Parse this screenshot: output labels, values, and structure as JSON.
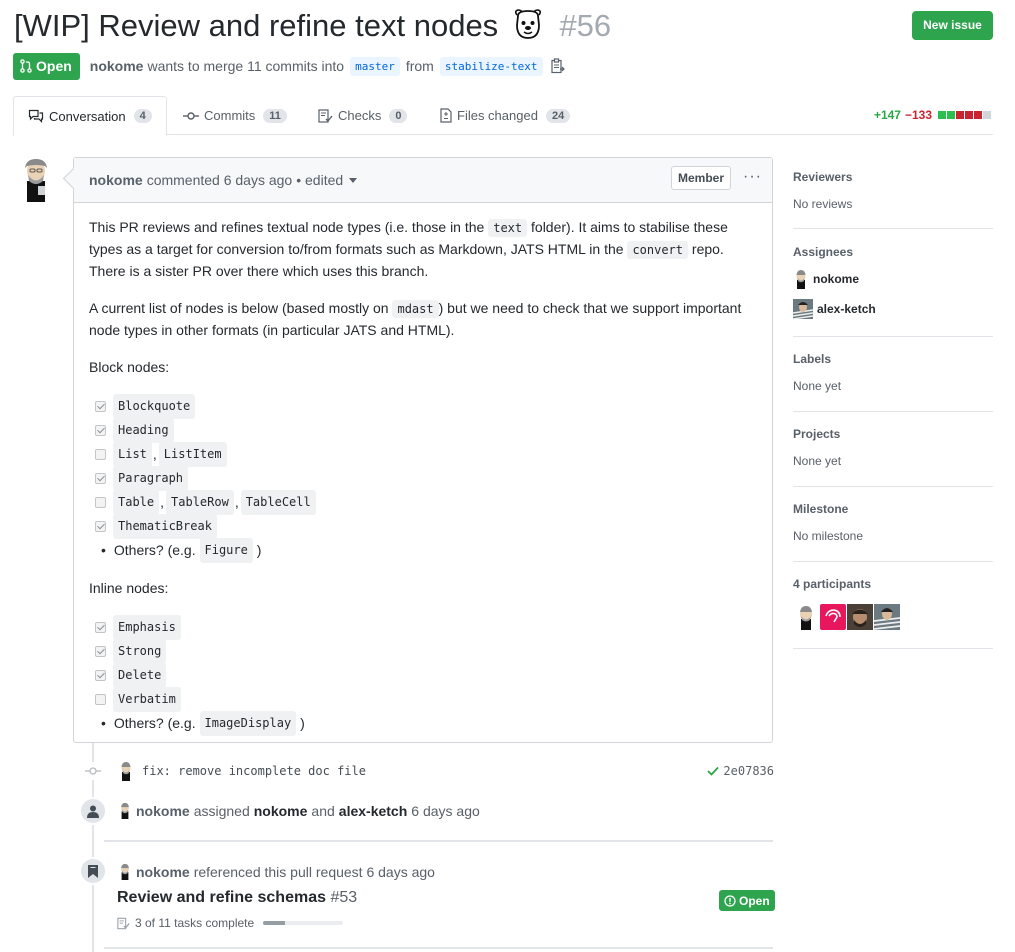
{
  "header": {
    "title": "[WIP] Review and refine text nodes",
    "number": "#56",
    "new_issue_label": "New issue",
    "state": "Open",
    "author": "nokome",
    "merge_text": "wants to merge 11 commits into",
    "base_branch": "master",
    "from_text": "from",
    "head_branch": "stabilize-text"
  },
  "tabs": [
    {
      "label": "Conversation",
      "count": "4"
    },
    {
      "label": "Commits",
      "count": "11"
    },
    {
      "label": "Checks",
      "count": "0"
    },
    {
      "label": "Files changed",
      "count": "24"
    }
  ],
  "diffstat": {
    "additions": "+147",
    "deletions": "−133",
    "blocks": [
      "add",
      "add",
      "del",
      "del",
      "del",
      "neutral"
    ]
  },
  "comment": {
    "author": "nokome",
    "action": "commented 6 days ago",
    "edited": "• edited",
    "role_badge": "Member",
    "p1_a": "This PR reviews and refines textual node types (i.e. those in the",
    "p1_code1": "text",
    "p1_b": "folder). It aims to stabilise these types as a target for conversion to/from formats such as Markdown, JATS HTML in the",
    "p1_code2": "convert",
    "p1_c": "repo. There is a sister PR over there which uses this branch.",
    "p2_a": "A current list of nodes is below (based mostly on",
    "p2_code": "mdast",
    "p2_b": ") but we need to check that we support important node types in other formats (in particular JATS and HTML).",
    "block_heading": "Block nodes:",
    "block_tasks": [
      {
        "checked": true,
        "items": [
          "Blockquote"
        ]
      },
      {
        "checked": true,
        "items": [
          "Heading"
        ]
      },
      {
        "checked": false,
        "items": [
          "List",
          "ListItem"
        ]
      },
      {
        "checked": true,
        "items": [
          "Paragraph"
        ]
      },
      {
        "checked": false,
        "items": [
          "Table",
          "TableRow",
          "TableCell"
        ]
      },
      {
        "checked": true,
        "items": [
          "ThematicBreak"
        ]
      }
    ],
    "block_other_a": "Others? (e.g.",
    "block_other_code": "Figure",
    "block_other_b": ")",
    "inline_heading": "Inline nodes:",
    "inline_tasks": [
      {
        "checked": true,
        "items": [
          "Emphasis"
        ]
      },
      {
        "checked": true,
        "items": [
          "Strong"
        ]
      },
      {
        "checked": true,
        "items": [
          "Delete"
        ]
      },
      {
        "checked": false,
        "items": [
          "Verbatim"
        ]
      }
    ],
    "inline_other_a": "Others? (e.g.",
    "inline_other_code": "ImageDisplay",
    "inline_other_b": ")"
  },
  "timeline": {
    "commit_message": "fix: remove incomplete doc file",
    "commit_sha": "2e07836",
    "assign_actor": "nokome",
    "assign_verb": "assigned",
    "assignee1": "nokome",
    "assign_and": "and",
    "assignee2": "alex-ketch",
    "assign_time": "6 days ago",
    "ref_actor": "nokome",
    "ref_text": "referenced this pull request 6 days ago",
    "ref_title": "Review and refine schemas",
    "ref_number": "#53",
    "ref_state": "Open",
    "ref_tasks": "3 of 11 tasks complete",
    "ref_progress": 0.27
  },
  "sidebar": {
    "reviewers_h": "Reviewers",
    "reviewers_v": "No reviews",
    "assignees_h": "Assignees",
    "assignees": [
      "nokome",
      "alex-ketch"
    ],
    "labels_h": "Labels",
    "labels_v": "None yet",
    "projects_h": "Projects",
    "projects_v": "None yet",
    "milestone_h": "Milestone",
    "milestone_v": "No milestone",
    "participants_h": "4 participants"
  },
  "colors": {
    "green": "#2ea44f",
    "red": "#cb2431",
    "link": "#0366d6"
  }
}
